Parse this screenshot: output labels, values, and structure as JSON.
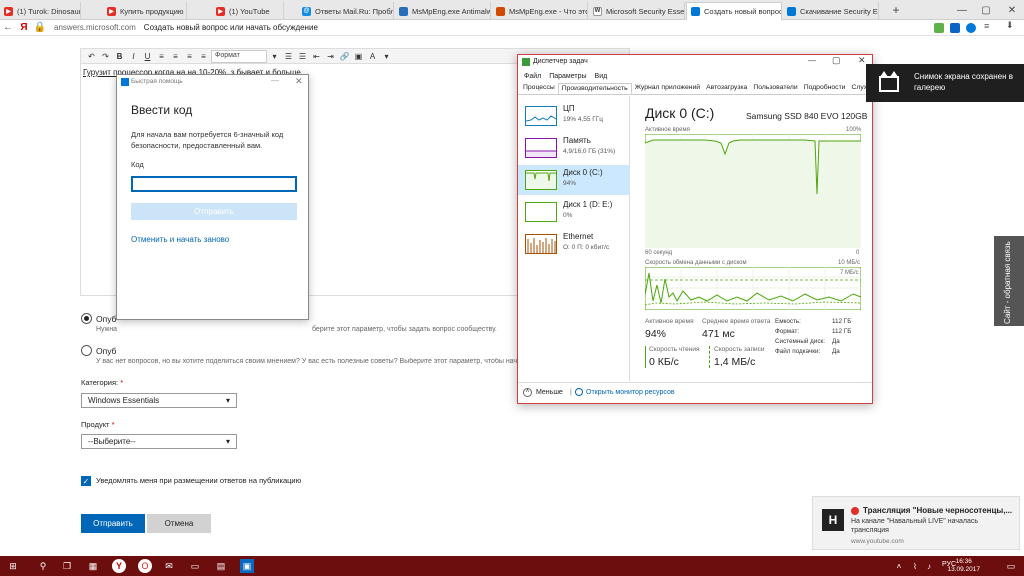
{
  "browser": {
    "tabs": [
      {
        "label": "(1) Turok: Dinosaur Hunte",
        "icon": "youtube-icon",
        "color": "#e52d27"
      },
      {
        "label": "Купить продукцию онла",
        "icon": "youtube-icon",
        "color": "#e52d27"
      },
      {
        "label": "(1) YouTube",
        "icon": "youtube-icon",
        "color": "#e52d27"
      },
      {
        "label": "Ответы Mail.Ru: Пробле",
        "icon": "mailru-icon",
        "color": "#168de2"
      },
      {
        "label": "MsMpEng.exe Antimalwa",
        "icon": "site-icon",
        "color": "#2a6ebb"
      },
      {
        "label": "MsMpEng.exe - Что это",
        "icon": "site-icon",
        "color": "#d04a02"
      },
      {
        "label": "Microsoft Security Essent",
        "icon": "wikipedia-icon",
        "color": "#777777"
      },
      {
        "label": "Создать новый вопрос",
        "icon": "microsoft-icon",
        "color": "#0078d7"
      },
      {
        "label": "Скачивание Security Esse",
        "icon": "microsoft-icon",
        "color": "#0078d7"
      }
    ],
    "active_tab": 7,
    "url": "answers.microsoft.com",
    "page_title": "Создать новый вопрос или начать обсуждение",
    "logo": "Я"
  },
  "editor": {
    "format_label": "Формат",
    "text": "Гурузит процессор когда на на 10-20%, з бывает и больше"
  },
  "form": {
    "option1_label": "Опуб",
    "option1_desc_left": "Нужна",
    "option1_desc_right": "берите этот параметр, чтобы задать вопрос сообществу.",
    "option2_label": "Опуб",
    "option2_desc": "У вас нет вопросов, но вы хотите поделиться своим мнением? У вас есть полезные советы? Выберите этот параметр, чтобы начать",
    "category_label": "Категория:",
    "category_required": "*",
    "category_value": "Windows Essentials",
    "product_label": "Продукт",
    "product_required": "*",
    "product_value": "--Выберите--",
    "notify_label": "Уведомлять меня при размещении ответов на публикацию",
    "submit_label": "Отправить",
    "cancel_label": "Отмена",
    "feedback_label": "Сайт - обратная связь"
  },
  "quick_assist": {
    "window_title": "Быстрая помощь",
    "heading": "Ввести код",
    "description": "Для начала вам потребуется 6-значный код безопасности, предоставленный вам.",
    "code_label": "Код",
    "code_value": "",
    "send_label": "Отправить",
    "cancel_link": "Отменить и начать заново"
  },
  "task_manager": {
    "title": "Диспетчер задач",
    "menu": [
      "Файл",
      "Параметры",
      "Вид"
    ],
    "tabs": [
      "Процессы",
      "Производительность",
      "Журнал приложений",
      "Автозагрузка",
      "Пользователи",
      "Подробности",
      "Службы"
    ],
    "active_tab": 1,
    "resources": [
      {
        "name": "ЦП",
        "value": "19% 4,55 ГГц",
        "color": "#117dbb"
      },
      {
        "name": "Память",
        "value": "4,9/16,0 ГБ (31%)",
        "color": "#8b12ae"
      },
      {
        "name": "Диск 0 (C:)",
        "value": "94%",
        "color": "#4da60c"
      },
      {
        "name": "Диск 1 (D: E:)",
        "value": "0%",
        "color": "#4da60c"
      },
      {
        "name": "Ethernet",
        "value": "О: 0 П: 0 кбит/с",
        "color": "#a74f01"
      }
    ],
    "selected_resource": 2,
    "disk_title": "Диск 0 (C:)",
    "disk_model": "Samsung SSD 840 EVO 120GB",
    "active_time_label": "Активное время",
    "active_time_max": "100%",
    "seconds_label": "60 секунд",
    "zero": "0",
    "transfer_label": "Скорость обмена данными с диском",
    "transfer_max": "10 МБ/с",
    "transfer_mid": "7 МБ/с",
    "stats": {
      "active_time_label": "Активное время",
      "active_time_value": "94%",
      "response_label": "Среднее время ответа",
      "response_value": "471 мс",
      "read_label": "Скорость чтения",
      "read_value": "0 КБ/с",
      "write_label": "Скорость записи",
      "write_value": "1,4 МБ/с"
    },
    "props": [
      {
        "key": "Емкость:",
        "value": "112 ГБ"
      },
      {
        "key": "Формат:",
        "value": "112 ГБ"
      },
      {
        "key": "Системный диск:",
        "value": "Да"
      },
      {
        "key": "Файл подкачки:",
        "value": "Да"
      }
    ],
    "less_label": "Меньше",
    "monitor_label": "Открыть монитор ресурсов",
    "colors": {
      "disk": "#4da60c",
      "disk_fill": "#eff7e8"
    }
  },
  "notifications": {
    "screenshot": "Снимок экрана сохранен в галерею",
    "yt_title": "Трансляция \"Новые черносотенцы,...",
    "yt_body": "На канале \"Навальный LIVE\" началась трансляция",
    "yt_source": "www.youtube.com"
  },
  "taskbar": {
    "time": "16:36",
    "date": "13.09.2017",
    "lang": "РУС",
    "color": "#6d0e0e"
  }
}
